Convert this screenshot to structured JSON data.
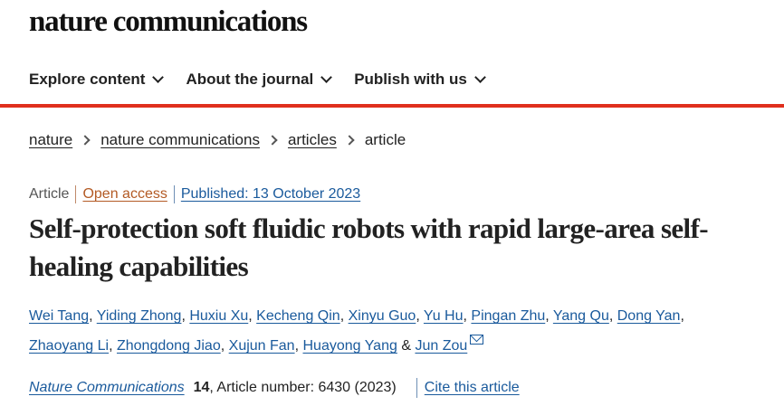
{
  "site": {
    "brand": "nature communications"
  },
  "nav": {
    "items": [
      {
        "label": "Explore content"
      },
      {
        "label": "About the journal"
      },
      {
        "label": "Publish with us"
      }
    ]
  },
  "breadcrumb": {
    "items": [
      "nature",
      "nature communications",
      "articles"
    ],
    "current": "article"
  },
  "article_meta": {
    "type": "Article",
    "access": "Open access",
    "published": "Published: 13 October 2023"
  },
  "title": "Self-protection soft fluidic robots with rapid large-area self-healing capabilities",
  "authors": [
    "Wei Tang",
    "Yiding Zhong",
    "Huxiu Xu",
    "Kecheng Qin",
    "Xinyu Guo",
    "Yu Hu",
    "Pingan Zhu",
    "Yang Qu",
    "Dong Yan",
    "Zhaoyang Li",
    "Zhongdong Jiao",
    "Xujun Fan",
    "Huayong Yang",
    "Jun Zou"
  ],
  "author_separators": {
    "comma": ",",
    "and": "&"
  },
  "citation": {
    "journal": "Nature Communications",
    "volume": "14",
    "details": ", Article number: 6430 (2023)",
    "cite_label": "Cite this article"
  },
  "colors": {
    "accent_red": "#e02f1d",
    "link_blue": "#1a5a9c",
    "open_access_orange": "#b35a24"
  },
  "icons": [
    "chevron-down-icon",
    "chevron-right-icon",
    "mail-icon"
  ]
}
